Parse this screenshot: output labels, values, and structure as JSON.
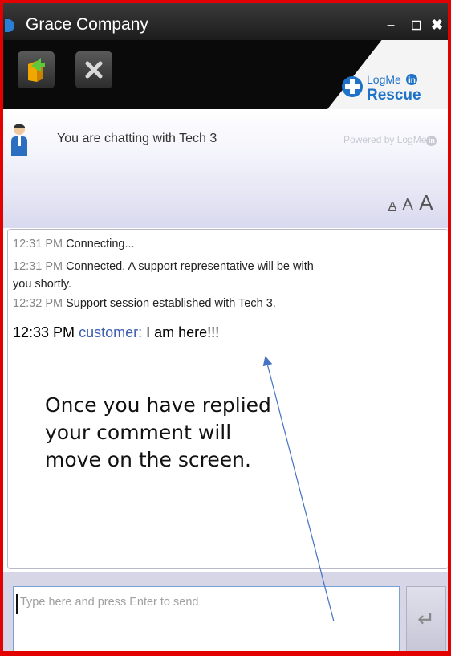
{
  "window": {
    "title": "Grace Company",
    "minimize": "–",
    "maximize": "☐",
    "close": "✖"
  },
  "toolbar": {
    "logo_text_top": "LogMe",
    "logo_text_in": "in",
    "logo_text_bottom": "Rescue"
  },
  "header": {
    "chatting_text": "You are chatting with Tech 3",
    "powered_by": "Powered by LogMe",
    "powered_in": "in",
    "font_sizes": [
      "A",
      "A",
      "A"
    ]
  },
  "chat": {
    "messages": [
      {
        "time": "12:31 PM",
        "text": "Connecting..."
      },
      {
        "time": "12:31 PM",
        "text": "Connected. A support representative will be with"
      },
      {
        "time": "",
        "text": "you shortly."
      },
      {
        "time": "12:32 PM",
        "text": "Support session established with Tech 3."
      }
    ],
    "highlight": {
      "time": "12:33 PM",
      "sender": "customer:",
      "text": "I am here!!!"
    },
    "annotation": [
      "Once you have replied",
      "your comment will",
      "move on the screen."
    ]
  },
  "input": {
    "placeholder": "Type here and press Enter to send",
    "send_symbol": "↵"
  },
  "colors": {
    "frame_border": "#e30000",
    "sender_color": "#3d5fb0",
    "logo_blue": "#1e72c8"
  }
}
